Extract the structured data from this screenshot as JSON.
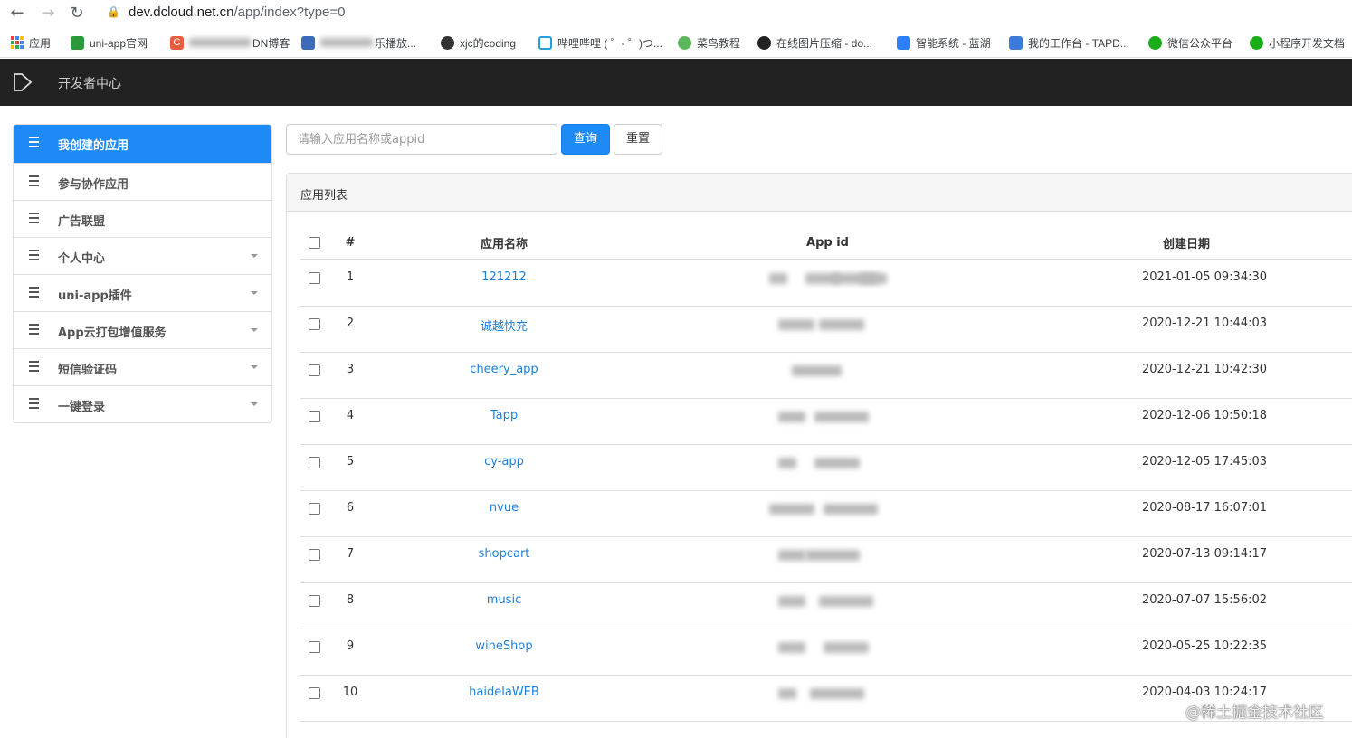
{
  "browser": {
    "url_host": "dev.dcloud.net.cn",
    "url_path": "/app/index?type=0",
    "bookmarks": [
      {
        "label": "应用",
        "color": "#4285f4"
      },
      {
        "label": "uni-app官网",
        "color": "#2b9939"
      },
      {
        "label": "DN博客",
        "color": "#e85d3c",
        "prefix": "C"
      },
      {
        "label": "乐播放...",
        "color": "#3a6ab8"
      },
      {
        "label": "xjc的coding",
        "color": "#333333"
      },
      {
        "label": "哔哩哔哩 ( ゜- ゜)つ...",
        "color": "#23a0d8"
      },
      {
        "label": "菜鸟教程",
        "color": "#5cb85c"
      },
      {
        "label": "在线图片压缩 - do...",
        "color": "#222222"
      },
      {
        "label": "智能系统 - 蓝湖",
        "color": "#2d7ff9"
      },
      {
        "label": "我的工作台 - TAPD...",
        "color": "#3b7bdc"
      },
      {
        "label": "微信公众平台",
        "color": "#1aad19"
      },
      {
        "label": "小程序开发文档",
        "color": "#1aad19"
      }
    ]
  },
  "header": {
    "title": "开发者中心"
  },
  "sidebar": {
    "items": [
      {
        "label": "我创建的应用",
        "active": true,
        "caret": false
      },
      {
        "label": "参与协作应用",
        "active": false,
        "caret": false
      },
      {
        "label": "广告联盟",
        "active": false,
        "caret": false
      },
      {
        "label": "个人中心",
        "active": false,
        "caret": true
      },
      {
        "label": "uni-app插件",
        "active": false,
        "caret": true
      },
      {
        "label": "App云打包增值服务",
        "active": false,
        "caret": true
      },
      {
        "label": "短信验证码",
        "active": false,
        "caret": true
      },
      {
        "label": "一键登录",
        "active": false,
        "caret": true
      }
    ]
  },
  "search": {
    "placeholder": "请输入应用名称或appid",
    "query_label": "查询",
    "reset_label": "重置"
  },
  "panel": {
    "title": "应用列表"
  },
  "table": {
    "headers": {
      "num": "#",
      "name": "应用名称",
      "appid": "App id",
      "date": "创建日期"
    },
    "rows": [
      {
        "num": "1",
        "name": "121212",
        "date": "2021-01-05 09:34:30"
      },
      {
        "num": "2",
        "name": "诚越快充",
        "date": "2020-12-21 10:44:03"
      },
      {
        "num": "3",
        "name": "cheery_app",
        "date": "2020-12-21 10:42:30"
      },
      {
        "num": "4",
        "name": "Tapp",
        "date": "2020-12-06 10:50:18"
      },
      {
        "num": "5",
        "name": "cy-app",
        "date": "2020-12-05 17:45:03"
      },
      {
        "num": "6",
        "name": "nvue",
        "date": "2020-08-17 16:07:01"
      },
      {
        "num": "7",
        "name": "shopcart",
        "date": "2020-07-13 09:14:17"
      },
      {
        "num": "8",
        "name": "music",
        "date": "2020-07-07 15:56:02"
      },
      {
        "num": "9",
        "name": "wineShop",
        "date": "2020-05-25 10:22:35"
      },
      {
        "num": "10",
        "name": "haidelaWEB",
        "date": "2020-04-03 10:24:17"
      }
    ]
  },
  "watermark": {
    "text": "@稀土掘金技术社区"
  },
  "colors": {
    "primary": "#1e8af6",
    "header_bg": "#222222",
    "link": "#1e7fd8"
  }
}
